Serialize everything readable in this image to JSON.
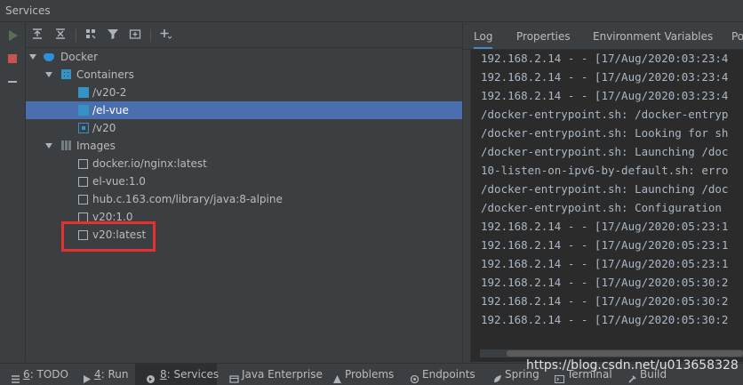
{
  "window": {
    "title": "Services"
  },
  "toolbar": {
    "icons": [
      "expand-all-icon",
      "collapse-all-icon",
      "group-icon",
      "filter-icon",
      "new-tab-icon",
      "add-icon"
    ]
  },
  "tree": {
    "root": {
      "label": "Docker"
    },
    "containers": {
      "label": "Containers",
      "items": [
        {
          "label": "/v20-2",
          "state": "stopped"
        },
        {
          "label": "/el-vue",
          "state": "stopped",
          "selected": true
        },
        {
          "label": "/v20",
          "state": "running"
        }
      ]
    },
    "images": {
      "label": "Images",
      "items": [
        {
          "label": "docker.io/nginx:latest"
        },
        {
          "label": "el-vue:1.0"
        },
        {
          "label": "hub.c.163.com/library/java:8-alpine"
        },
        {
          "label": "v20:1.0"
        },
        {
          "label": "v20:latest",
          "highlighted": true
        }
      ]
    }
  },
  "right_panel": {
    "tabs": [
      "Log",
      "Properties",
      "Environment Variables",
      "Po"
    ],
    "active_tab": "Log",
    "log_lines": [
      "192.168.2.14 - - [17/Aug/2020:03:23:4",
      "192.168.2.14 - - [17/Aug/2020:03:23:4",
      "192.168.2.14 - - [17/Aug/2020:03:23:4",
      "/docker-entrypoint.sh: /docker-entryp",
      "/docker-entrypoint.sh: Looking for sh",
      "/docker-entrypoint.sh: Launching /doc",
      "10-listen-on-ipv6-by-default.sh: erro",
      "/docker-entrypoint.sh: Launching /doc",
      "/docker-entrypoint.sh: Configuration ",
      "192.168.2.14 - - [17/Aug/2020:05:23:1",
      "192.168.2.14 - - [17/Aug/2020:05:23:1",
      "192.168.2.14 - - [17/Aug/2020:05:23:1",
      "192.168.2.14 - - [17/Aug/2020:05:30:2",
      "192.168.2.14 - - [17/Aug/2020:05:30:2",
      "192.168.2.14 - - [17/Aug/2020:05:30:2"
    ]
  },
  "bottom_tabs": [
    {
      "num": "6",
      "label": ": TODO"
    },
    {
      "num": "4",
      "label": ": Run"
    },
    {
      "num": "8",
      "label": ": Services",
      "active": true
    },
    {
      "num": "",
      "label": "Java Enterprise"
    },
    {
      "num": "",
      "label": "Problems"
    },
    {
      "num": "",
      "label": "Endpoints"
    },
    {
      "num": "",
      "label": "Spring"
    },
    {
      "num": "",
      "label": "Terminal"
    },
    {
      "num": "",
      "label": "Build"
    }
  ],
  "watermark": "https://blog.csdn.net/u013658328",
  "colors": {
    "selection": "#4b6eaf",
    "highlight_box": "#e8312f",
    "accent": "#4a88c7"
  }
}
